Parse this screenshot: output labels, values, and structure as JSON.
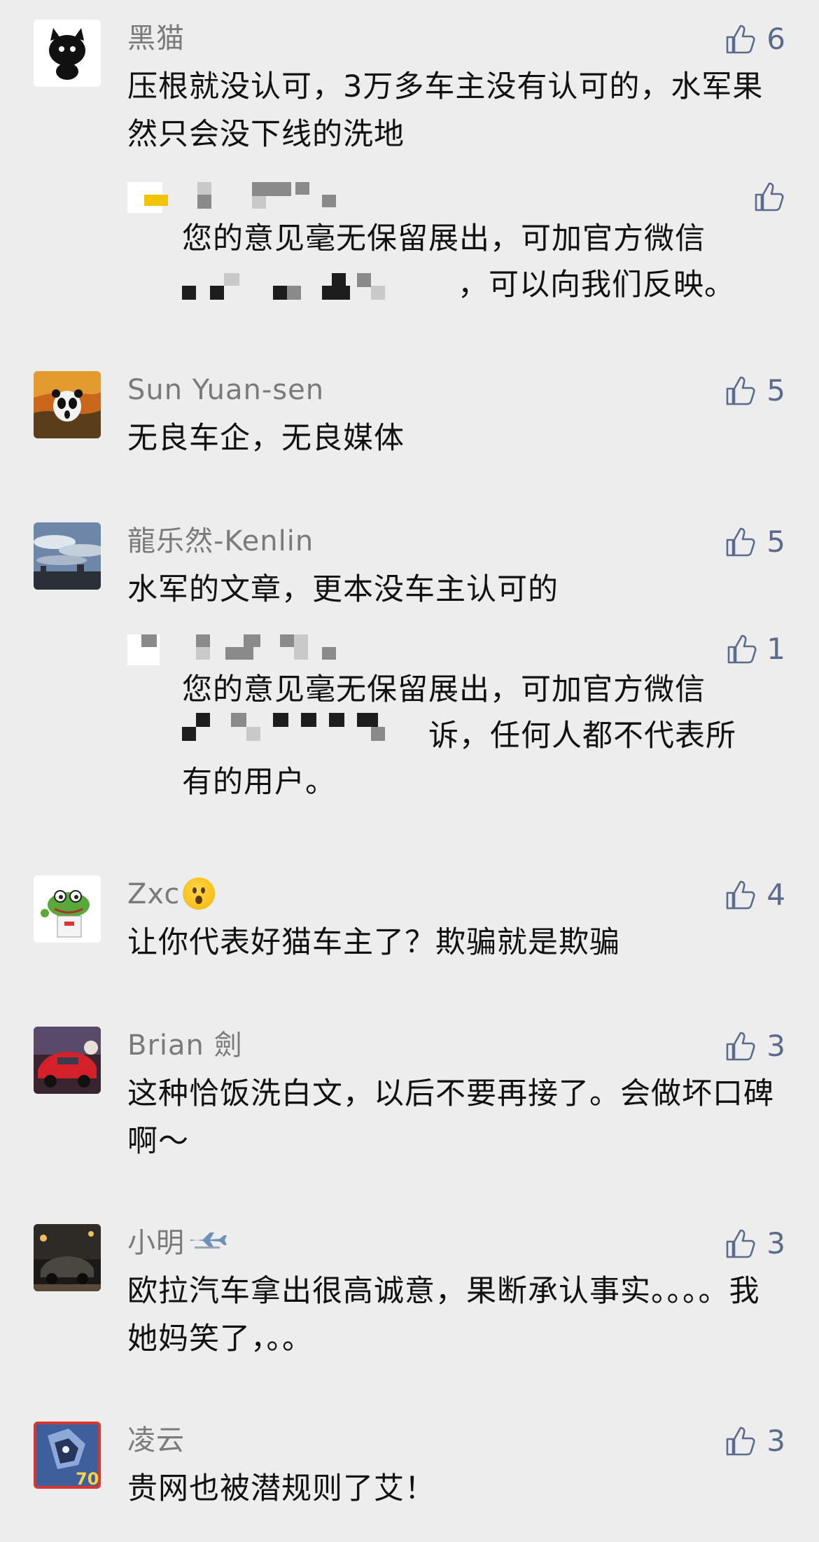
{
  "colors": {
    "background": "#ededed",
    "like": "#5b6b8c",
    "name": "#7a7a7a",
    "text": "#111111"
  },
  "comments": [
    {
      "name": "黑猫",
      "text": "压根就没认可，3万多车主没有认可的，水军果然只会没下线的洗地",
      "likes": "6",
      "avatar": "black-cat-avatar",
      "reply": {
        "text_line1": "您的意见毫无保留展出，可加官方微信",
        "text_line2_suffix": "，可以向我们反映。",
        "likes": ""
      }
    },
    {
      "name": "Sun Yuan-sen",
      "text": "无良车企，无良媒体",
      "likes": "5",
      "avatar": "panda-scream-avatar"
    },
    {
      "name": "龍乐然-Kenlin",
      "text": "水军的文章，更本没车主认可的",
      "likes": "5",
      "avatar": "sky-photo-avatar",
      "reply": {
        "text_line1": "您的意见毫无保留展出，可加官方微信",
        "text_line2_suffix": "诉，任何人都不代表所",
        "text_line3": "有的用户。",
        "likes": "1"
      }
    },
    {
      "name": "Zxc",
      "name_emoji": "surprised-emoji-icon",
      "text": "让你代表好猫车主了？欺骗就是欺骗",
      "likes": "4",
      "avatar": "frog-avatar"
    },
    {
      "name": "Brian 劍",
      "text": "这种恰饭洗白文，以后不要再接了。会做坏口碑啊～",
      "likes": "3",
      "avatar": "red-car-avatar"
    },
    {
      "name": "小明",
      "name_emoji": "airplane-icon",
      "text": "欧拉汽车拿出很高诚意，果断承认事实。。。。我她妈笑了，。。",
      "likes": "3",
      "avatar": "night-car-avatar"
    },
    {
      "name": "凌云",
      "text": "贵网也被潜规则了艾！",
      "likes": "3",
      "avatar": "robot-70-avatar"
    }
  ]
}
